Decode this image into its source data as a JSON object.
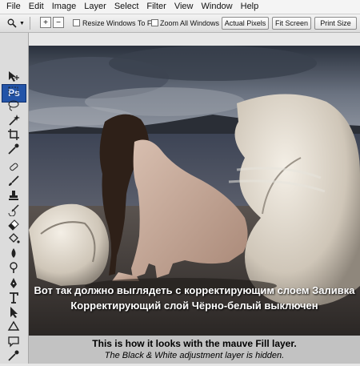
{
  "menubar": {
    "items": [
      "File",
      "Edit",
      "Image",
      "Layer",
      "Select",
      "Filter",
      "View",
      "Window",
      "Help"
    ]
  },
  "options_bar": {
    "tool_icon": "zoom-magnifier-icon",
    "zoom_in_symbol": "+",
    "zoom_out_symbol": "−",
    "resize_windows_label": "Resize Windows To Fit",
    "resize_windows_checked": false,
    "zoom_all_label": "Zoom All Windows",
    "zoom_all_checked": false,
    "buttons": [
      "Actual Pixels",
      "Fit Screen",
      "Print Size"
    ]
  },
  "toolbox": {
    "logo": "Ps",
    "tools": [
      "move-icon",
      "marquee-icon",
      "lasso-icon",
      "magic-wand-icon",
      "crop-icon",
      "eyedropper-icon",
      "healing-brush-icon",
      "brush-icon",
      "clone-stamp-icon",
      "history-brush-icon",
      "eraser-icon",
      "paint-bucket-icon",
      "blur-icon",
      "dodge-icon",
      "pen-icon",
      "type-icon",
      "path-selection-icon",
      "shape-icon",
      "notes-icon",
      "eyedropper-2-icon"
    ]
  },
  "canvas": {
    "caption_ru_1": "Вот так должно выглядеть с корректирующим слоем Заливка",
    "caption_ru_2": "Корректирующий слой Чёрно-белый выключен",
    "caption_en_1": "This is how it looks with the mauve Fill layer.",
    "caption_en_2": "The Black & White adjustment layer is hidden."
  },
  "colors": {
    "ps_logo_bg": "#2354a8",
    "caption_bar_bg": "#c2c2c2"
  }
}
